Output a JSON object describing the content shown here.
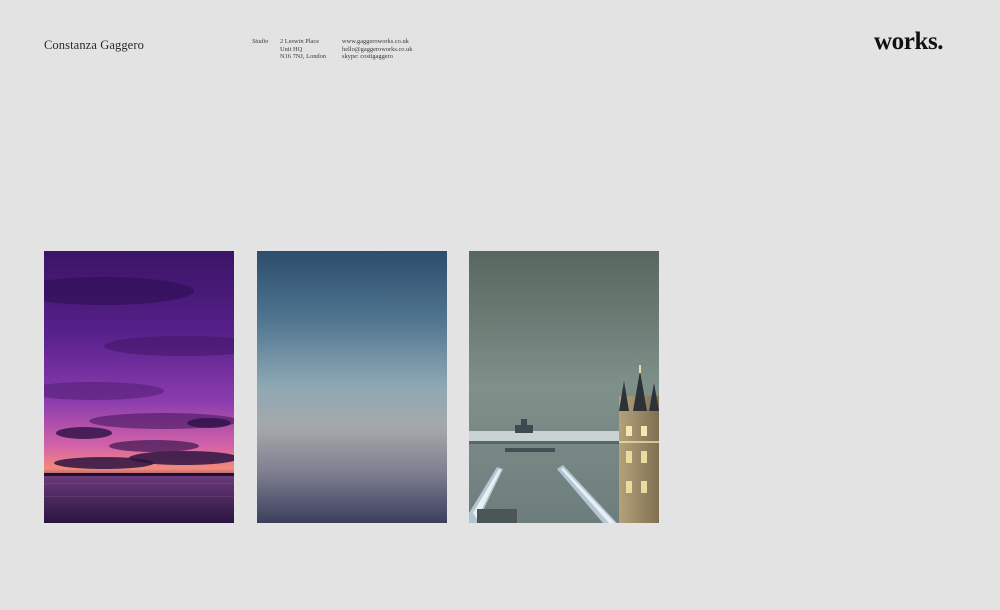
{
  "header": {
    "site_name": "Constanza Gaggero",
    "studio_label": "Studio",
    "address": [
      "2 Leswin Place",
      "Unit HQ",
      "N16 7NJ, London"
    ],
    "links": [
      "www.gaggeroworks.co.uk",
      "hello@gaggeroworks.co.uk",
      "skype: costigaggero"
    ],
    "logo": "works."
  },
  "gallery": {
    "items": [
      {
        "name": "purple-sunset-river"
      },
      {
        "name": "blue-gradient-sky"
      },
      {
        "name": "tower-bridge-night"
      }
    ]
  },
  "colors": {
    "background": "#e3e3e3",
    "text": "#222222"
  }
}
